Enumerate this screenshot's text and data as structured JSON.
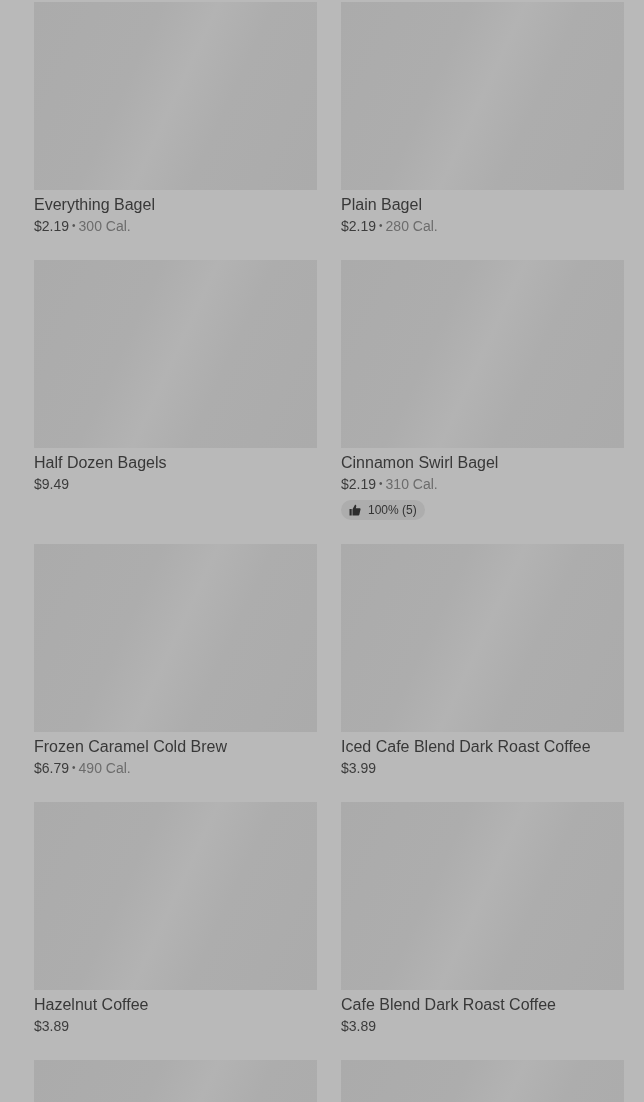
{
  "items": [
    {
      "kind": "picture",
      "name": "Everything Bagel",
      "price": "$2.19",
      "separator": "•",
      "calories": "300 Cal."
    },
    {
      "kind": "picture",
      "name": "Plain Bagel",
      "price": "$2.19",
      "separator": "•",
      "calories": "280 Cal."
    },
    {
      "kind": "picture",
      "name": "Half Dozen Bagels",
      "price": "$9.49"
    },
    {
      "kind": "picture",
      "name": "Cinnamon Swirl Bagel",
      "price": "$2.19",
      "separator": "•",
      "calories": "310 Cal.",
      "rating": "100% (5)"
    },
    {
      "kind": "picture",
      "name": "Frozen Caramel Cold Brew",
      "price": "$6.79",
      "separator": "•",
      "calories": "490 Cal."
    },
    {
      "kind": "picture",
      "name": "Iced Cafe Blend Dark Roast Coffee",
      "price": "$3.99"
    },
    {
      "kind": "picture",
      "name": "Hazelnut Coffee",
      "price": "$3.89"
    },
    {
      "kind": "picture",
      "name": "Cafe Blend Dark Roast Coffee",
      "price": "$3.89"
    },
    {
      "kind": "picture"
    },
    {
      "kind": "picture"
    }
  ]
}
